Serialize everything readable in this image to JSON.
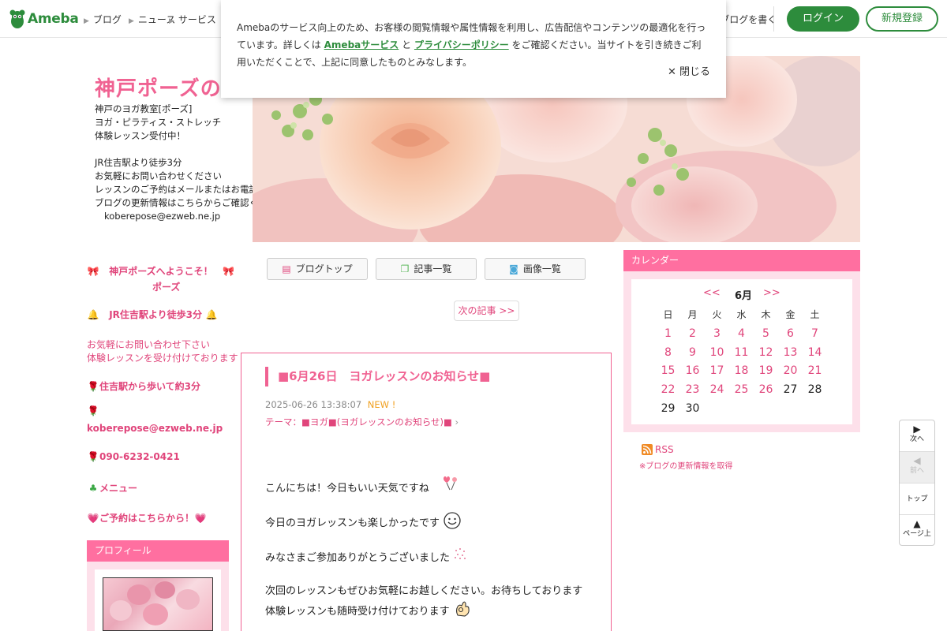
{
  "header": {
    "logo_text": "Ameba",
    "nav": [
      "ブログ",
      "ニュース",
      "サービス"
    ],
    "right_link": "ブログを書く",
    "login_button": "ログイン",
    "signup_button": "新規登録"
  },
  "notice": {
    "text_before": "Amebaのサービス向上のため、お客様の閲覧情報や属性情報を利用し、広告配信やコンテンツの最適化を行っています。詳しくは",
    "link1": "Amebaサービス",
    "text_mid": "と",
    "link2": "プライバシーポリシー",
    "text_after": "をご確認ください。当サイトを引き続きご利用いただくことで、上記に同意したものとみなします。",
    "close_label": "閉じる"
  },
  "blog": {
    "title": "神戸ポーズのブログ日記",
    "desc": [
      "神戸のヨガ教室[ポーズ]",
      "ヨガ・ピラティス・ストレッチ",
      "体験レッスン受付中！",
      "",
      "JR住吉駅より徒歩3分",
      "お気軽にお問い合わせください",
      "レッスンのご予約はメールまたはお電話で",
      "ブログの更新情報はこちらからご確認ください"
    ],
    "email": "koberepose@ezweb.ne.jp"
  },
  "side_profile": {
    "welcome": "神戸ポーズへようこそ！",
    "welcome2": "ポーズ",
    "station": "JR住吉駅より徒歩3分",
    "note1": "お気軽にお問い合わせ下さい",
    "note2": "体験レッスンを受け付けております",
    "address": "住吉駅から歩いて約3分",
    "email": "koberepose@ezweb.ne.jp",
    "phone": "090-6232-0421",
    "menu": "メニュー",
    "reserve": "ご予約はこちらから！"
  },
  "side_box": {
    "title": "プロフィール"
  },
  "tabs": [
    "ブログトップ",
    "記事一覧",
    "画像一覧"
  ],
  "more_link": "次の記事 >>",
  "article": {
    "title": "■6月26日　ヨガレッスンのお知らせ■",
    "date": "2025-06-26 13:38:07",
    "new_label": "NEW !",
    "category": "テーマ：■ヨガ■(ヨガレッスンのお知らせ)■",
    "lines": [
      "こんにちは！今日もいい天気ですね",
      "今日のヨガレッスンも楽しかったです",
      "みなさまご参加ありがとうございました",
      "次回のレッスンもぜひお気軽にお越しください。お待ちしております",
      "体験レッスンも随時受け付けております"
    ]
  },
  "calendar": {
    "title": "カレンダー",
    "prev": "<<",
    "month": "6月",
    "next": ">>",
    "weekdays": [
      "日",
      "月",
      "火",
      "水",
      "木",
      "金",
      "土"
    ],
    "weeks": [
      [
        "1",
        "2",
        "3",
        "4",
        "5",
        "6",
        "7"
      ],
      [
        "8",
        "9",
        "10",
        "11",
        "12",
        "13",
        "14"
      ],
      [
        "15",
        "16",
        "17",
        "18",
        "19",
        "20",
        "21"
      ],
      [
        "22",
        "23",
        "24",
        "25",
        "26",
        "27",
        "28"
      ],
      [
        "29",
        "30",
        "",
        "",
        "",
        "",
        ""
      ]
    ],
    "linked_days_upto": 26
  },
  "rss": {
    "label": "RSS",
    "note": "※ブログの更新情報を取得"
  },
  "pager": {
    "next": "次へ",
    "prev": "前へ",
    "top": "トップ",
    "pagetop": "ページ上"
  },
  "colors": {
    "accent": "#f06292",
    "ameba_green": "#2d8c3c",
    "box_bg": "#fde0ea",
    "box_head": "#ff6fa0"
  }
}
